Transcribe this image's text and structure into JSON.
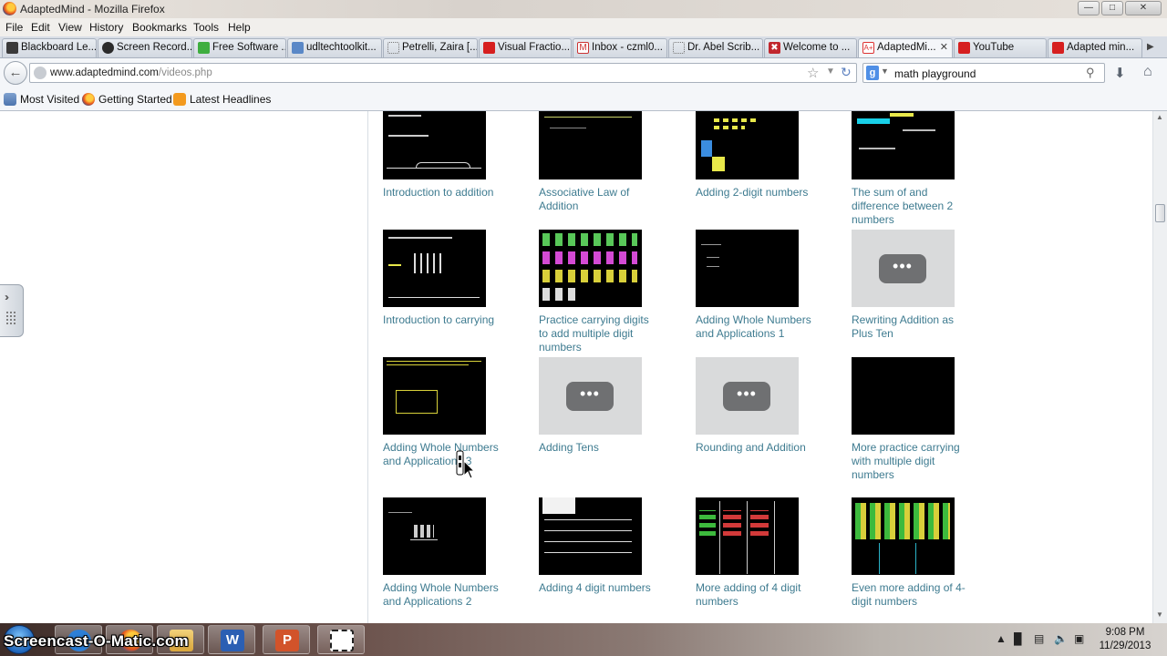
{
  "window": {
    "title": "AdaptedMind - Mozilla Firefox"
  },
  "menu": {
    "items": [
      "File",
      "Edit",
      "View",
      "History",
      "Bookmarks",
      "Tools",
      "Help"
    ]
  },
  "tabs": [
    {
      "label": "Blackboard Le..."
    },
    {
      "label": "Screen Record..."
    },
    {
      "label": "Free Software ..."
    },
    {
      "label": "udltechtoolkit..."
    },
    {
      "label": "Petrelli, Zaira [..."
    },
    {
      "label": "Visual Fractio..."
    },
    {
      "label": "Inbox - czml0..."
    },
    {
      "label": "Dr. Abel Scrib..."
    },
    {
      "label": "Welcome to ..."
    },
    {
      "label": "AdaptedMi..."
    },
    {
      "label": "YouTube"
    },
    {
      "label": "Adapted min..."
    }
  ],
  "navbar": {
    "url_domain": "www.adaptedmind.com",
    "url_path": "/videos.php",
    "search_value": "math playground"
  },
  "bookmarks": [
    {
      "label": "Most Visited"
    },
    {
      "label": "Getting Started"
    },
    {
      "label": "Latest Headlines"
    }
  ],
  "videos": [
    {
      "title": "Introduction to addition"
    },
    {
      "title": "Associative Law of Addition"
    },
    {
      "title": "Adding 2-digit numbers"
    },
    {
      "title": "The sum of and difference between 2 numbers"
    },
    {
      "title": "Introduction to carrying"
    },
    {
      "title": "Practice carrying digits to add multiple digit numbers"
    },
    {
      "title": "Adding Whole Numbers and Applications 1"
    },
    {
      "title": "Rewriting Addition as Plus Ten"
    },
    {
      "title": "Adding Whole Numbers and Applications 3"
    },
    {
      "title": "Adding Tens"
    },
    {
      "title": "Rounding and Addition"
    },
    {
      "title": "More practice carrying with multiple digit numbers"
    },
    {
      "title": "Adding Whole Numbers and Applications 2"
    },
    {
      "title": "Adding 4 digit numbers"
    },
    {
      "title": "More adding of 4 digit numbers"
    },
    {
      "title": "Even more adding of 4-digit numbers"
    }
  ],
  "taskbar": {
    "watermark": "Screencast-O-Matic.com",
    "time": "9:08 PM",
    "date": "11/29/2013"
  }
}
